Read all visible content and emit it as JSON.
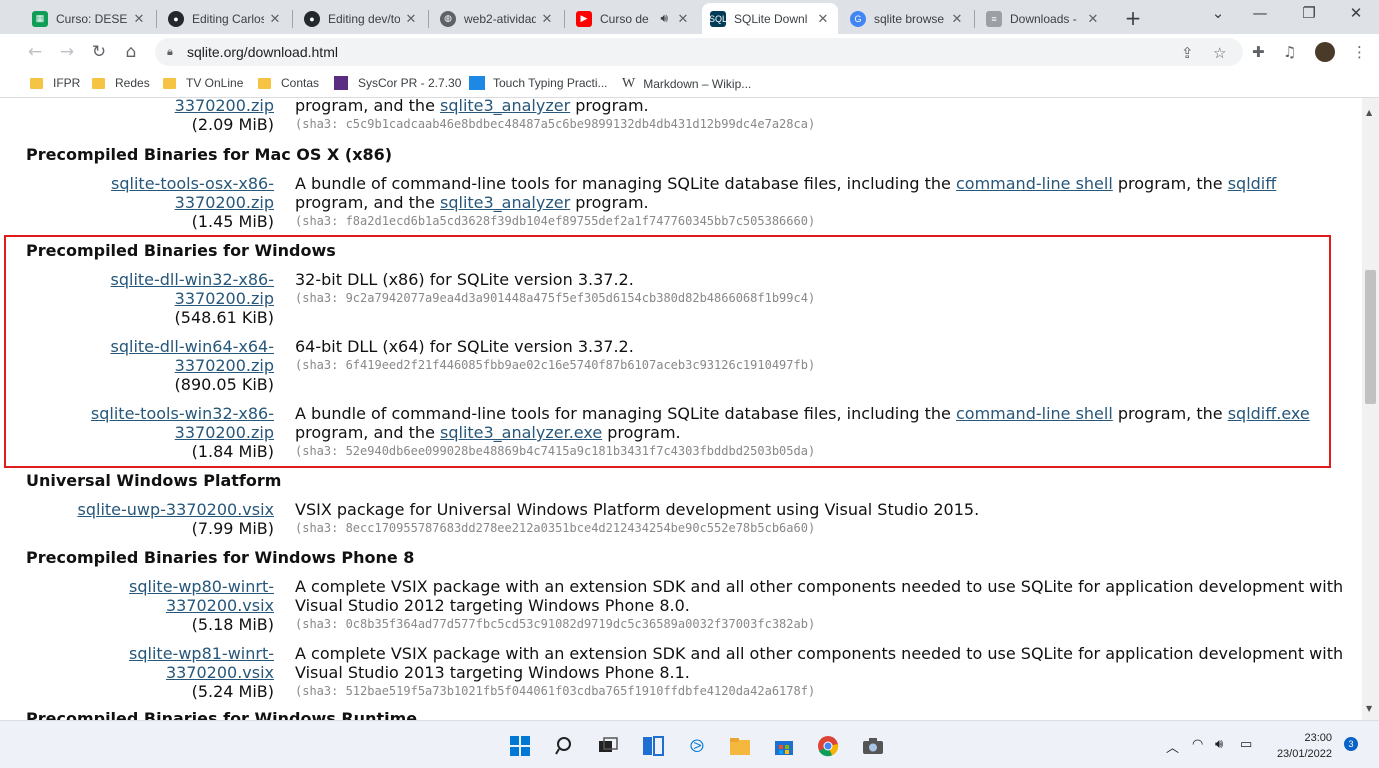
{
  "browser": {
    "tabs": [
      {
        "title": "Curso: DESENV",
        "favicon": "sheet-icon",
        "color": "#0f9d58"
      },
      {
        "title": "Editing Carlos",
        "favicon": "github-icon",
        "color": "#24292e"
      },
      {
        "title": "Editing dev/to",
        "favicon": "github-icon",
        "color": "#24292e"
      },
      {
        "title": "web2-atividad",
        "favicon": "globe-icon",
        "color": "#5f6368"
      },
      {
        "title": "Curso de",
        "favicon": "youtube-icon",
        "color": "#ff0000"
      },
      {
        "title": "SQLite Downl",
        "favicon": "sqlite-icon",
        "color": "#003b57"
      },
      {
        "title": "sqlite browse",
        "favicon": "google-icon",
        "color": "#4285f4"
      },
      {
        "title": "Downloads - ",
        "favicon": "database-icon",
        "color": "#9aa0a6"
      }
    ],
    "url": "sqlite.org/download.html",
    "bookmarks": [
      {
        "label": "IFPR",
        "icon": "folder-icon"
      },
      {
        "label": "Redes",
        "icon": "folder-icon"
      },
      {
        "label": "TV OnLine",
        "icon": "folder-icon"
      },
      {
        "label": "Contas",
        "icon": "folder-icon"
      },
      {
        "label": "SysCor PR - 2.7.30",
        "icon": "syscor-icon"
      },
      {
        "label": "Touch Typing Practi...",
        "icon": "ts-icon"
      },
      {
        "label": "Markdown – Wikip...",
        "icon": "wikipedia-icon"
      }
    ]
  },
  "page": {
    "top_entry": {
      "file_line2": "3370200.zip",
      "size": "(2.09 MiB)",
      "desc_pre": "program, and the ",
      "desc_link": "sqlite3_analyzer",
      "desc_post": " program.",
      "sha": "(sha3: c5c9b1cadcaab46e8bdbec48487a5c6be9899132db4db431d12b99dc4e7a28ca)"
    },
    "sections": {
      "macos": {
        "title": "Precompiled Binaries for Mac OS X (x86)",
        "entries": [
          {
            "file_line1": "sqlite-tools-osx-x86-",
            "file_line2": "3370200.zip",
            "size": "(1.45 MiB)",
            "d1_pre": "A bundle of command-line tools for managing SQLite database files, including the ",
            "d1_link1": "command-line shell",
            "d1_mid": " program, the ",
            "d1_link2": "sqldiff",
            "d2_pre": "program, and the ",
            "d2_link": "sqlite3_analyzer",
            "d2_post": " program.",
            "sha": "(sha3: f8a2d1ecd6b1a5cd3628f39db104ef89755def2a1f747760345bb7c505386660)"
          }
        ]
      },
      "windows": {
        "title": "Precompiled Binaries for Windows",
        "entries": [
          {
            "file_line1": "sqlite-dll-win32-x86-",
            "file_line2": "3370200.zip",
            "size": "(548.61 KiB)",
            "desc": "32-bit DLL (x86) for SQLite version 3.37.2.",
            "sha": "(sha3: 9c2a7942077a9ea4d3a901448a475f5ef305d6154cb380d82b4866068f1b99c4)"
          },
          {
            "file_line1": "sqlite-dll-win64-x64-",
            "file_line2": "3370200.zip",
            "size": "(890.05 KiB)",
            "desc": "64-bit DLL (x64) for SQLite version 3.37.2.",
            "sha": "(sha3: 6f419eed2f21f446085fbb9ae02c16e5740f87b6107aceb3c93126c1910497fb)"
          },
          {
            "file_line1": "sqlite-tools-win32-x86-",
            "file_line2": "3370200.zip",
            "size": "(1.84 MiB)",
            "d1_pre": "A bundle of command-line tools for managing SQLite database files, including the ",
            "d1_link1": "command-line shell",
            "d1_mid": " program, the ",
            "d1_link2": "sqldiff.exe",
            "d2_pre": "program, and the ",
            "d2_link": "sqlite3_analyzer.exe",
            "d2_post": " program.",
            "sha": "(sha3: 52e940db6ee099028be48869b4c7415a9c181b3431f7c4303fbddbd2503b05da)"
          }
        ]
      },
      "uwp": {
        "title": "Universal Windows Platform",
        "entries": [
          {
            "file_line1": "sqlite-uwp-3370200.vsix",
            "size": "(7.99 MiB)",
            "desc": "VSIX package for Universal Windows Platform development using Visual Studio 2015.",
            "sha": "(sha3: 8ecc170955787683dd278ee212a0351bce4d212434254be90c552e78b5cb6a60)"
          }
        ]
      },
      "wp8": {
        "title": "Precompiled Binaries for Windows Phone 8",
        "entries": [
          {
            "file_line1": "sqlite-wp80-winrt-",
            "file_line2": "3370200.vsix",
            "size": "(5.18 MiB)",
            "d1": "A complete VSIX package with an extension SDK and all other components needed to use SQLite for application development with",
            "d2": "Visual Studio 2012 targeting Windows Phone 8.0.",
            "sha": "(sha3: 0c8b35f364ad77d577fbc5cd53c91082d9719dc5c36589a0032f37003fc382ab)"
          },
          {
            "file_line1": "sqlite-wp81-winrt-",
            "file_line2": "3370200.vsix",
            "size": "(5.24 MiB)",
            "d1": "A complete VSIX package with an extension SDK and all other components needed to use SQLite for application development with",
            "d2": "Visual Studio 2013 targeting Windows Phone 8.1.",
            "sha": "(sha3: 512bae519f5a73b1021fb5f044061f03cdba765f1910ffdbfe4120da42a6178f)"
          }
        ]
      },
      "runtime": {
        "title": "Precompiled Binaries for Windows Runtime"
      }
    },
    "annotation_color": "#e01b1b"
  },
  "taskbar": {
    "time": "23:00",
    "date": "23/01/2022",
    "notifications": "3",
    "apps": [
      "windows-start-icon",
      "search-icon",
      "task-view-icon",
      "widgets-icon",
      "vscode-icon",
      "file-explorer-icon",
      "store-icon",
      "chrome-icon",
      "camera-icon"
    ]
  }
}
